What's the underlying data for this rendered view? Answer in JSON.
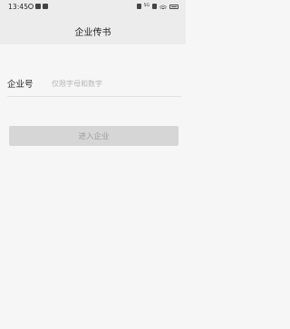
{
  "status_bar": {
    "time": "13:45",
    "network_label": "5G"
  },
  "header": {
    "title": "企业传书"
  },
  "form": {
    "company_id_label": "企业号",
    "company_id_placeholder": "仅限字母和数字",
    "company_id_value": ""
  },
  "actions": {
    "enter_label": "进入企业"
  }
}
